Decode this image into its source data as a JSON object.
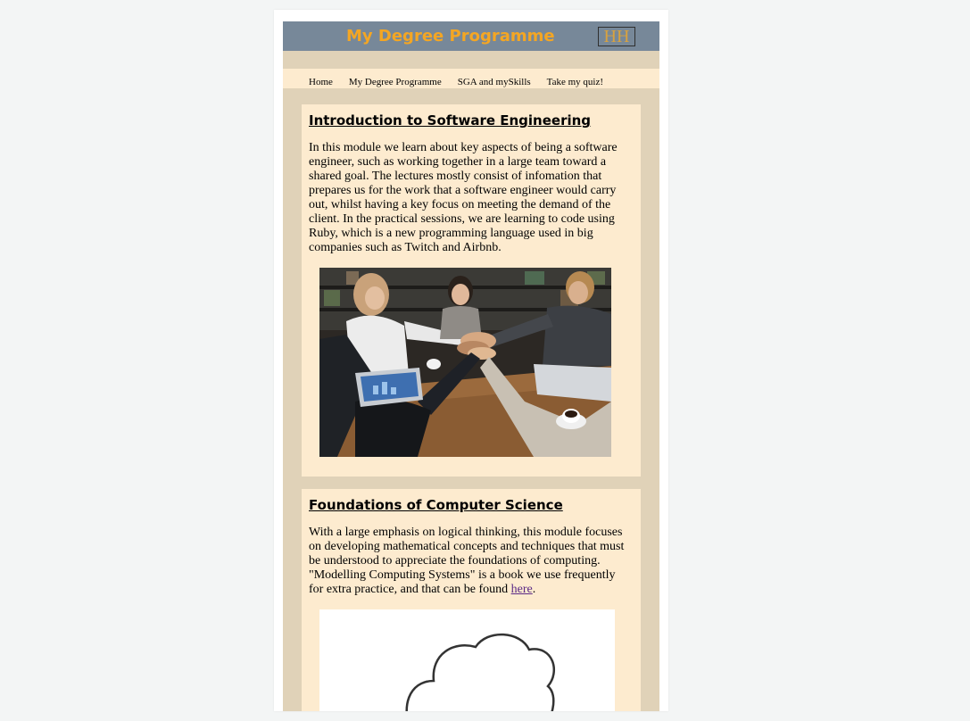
{
  "header": {
    "title": "My Degree Programme",
    "logo_text": "HH"
  },
  "nav": {
    "items": [
      "Home",
      "My Degree Programme",
      "SGA and mySkills",
      "Take my quiz!"
    ]
  },
  "modules": [
    {
      "title": "Introduction to Software Engineering",
      "text": "In this module we learn about key aspects of being a software engineer, such as working together in a large team toward a shared goal. The lectures mostly consist of infomation that prepares us for the work that a software engineer would carry out, whilst having a key focus on meeting the demand of the client. In the practical sessions, we are learning to code using Ruby, which is a new programming language used in big companies such as Twitch and Airbnb."
    },
    {
      "title": "Foundations of Computer Science",
      "text_before_link": "With a large emphasis on logical thinking, this module focuses on developing mathematical concepts and techniques that must be understood to appreciate the foundations of computing. \"Modelling Computing Systems\" is a book we use frequently for extra practice, and that can be found ",
      "link_text": "here",
      "text_after_link": "."
    }
  ],
  "colors": {
    "header_bg": "#778899",
    "title": "#f4a623",
    "frame_bg": "#e0d2b8",
    "card_bg": "#fdebcf",
    "link": "#5b2a86"
  }
}
